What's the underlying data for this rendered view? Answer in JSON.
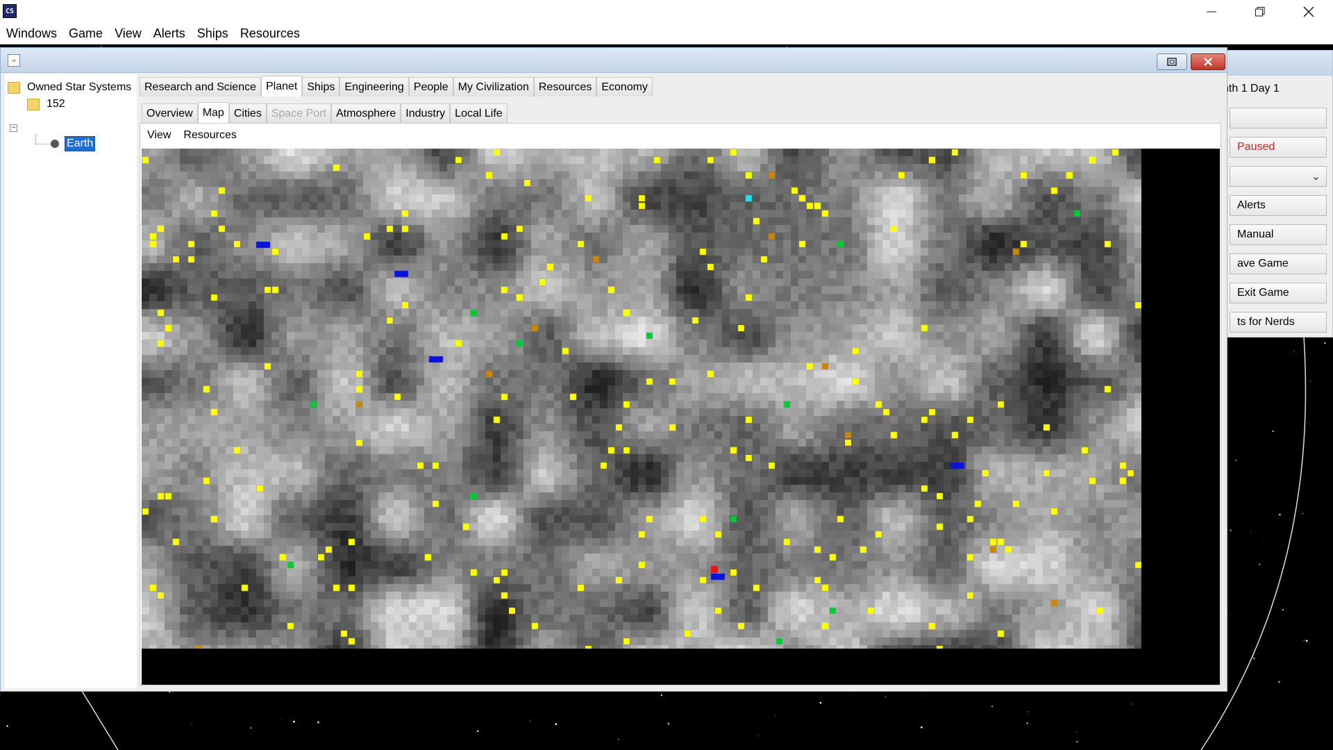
{
  "menu": [
    "Windows",
    "Game",
    "View",
    "Alerts",
    "Ships",
    "Resources"
  ],
  "tree": {
    "root": "Owned Star Systems",
    "system": "152",
    "planet": "Earth"
  },
  "tabs": {
    "outer": [
      {
        "label": "Research and Science",
        "active": false
      },
      {
        "label": "Planet",
        "active": true
      },
      {
        "label": "Ships",
        "active": false
      },
      {
        "label": "Engineering",
        "active": false
      },
      {
        "label": "People",
        "active": false
      },
      {
        "label": "My Civilization",
        "active": false
      },
      {
        "label": "Resources",
        "active": false
      },
      {
        "label": "Economy",
        "active": false
      }
    ],
    "inner": [
      {
        "label": "Overview",
        "active": false,
        "disabled": false
      },
      {
        "label": "Map",
        "active": true,
        "disabled": false
      },
      {
        "label": "Cities",
        "active": false,
        "disabled": false
      },
      {
        "label": "Space Port",
        "active": false,
        "disabled": true
      },
      {
        "label": "Atmosphere",
        "active": false,
        "disabled": false
      },
      {
        "label": "Industry",
        "active": false,
        "disabled": false
      },
      {
        "label": "Local Life",
        "active": false,
        "disabled": false
      }
    ]
  },
  "content_menu": {
    "view": "View",
    "resources": "Resources"
  },
  "right_panel": {
    "date": "nth 1 Day 1",
    "status": "Paused",
    "alerts": "Alerts",
    "manual": "Manual",
    "save": "ave Game",
    "exit": "Exit Game",
    "nerds": "ts for Nerds"
  },
  "colors": {
    "resource_yellow": "#ffff00",
    "resource_orange": "#c8860a",
    "resource_green": "#00cc33",
    "resource_blue": "#0a14d8",
    "resource_cyan": "#21e0ee",
    "resource_red": "#ee1111",
    "selection": "#1c6fd8",
    "paused": "#d62020"
  },
  "icons": [
    "app-icon",
    "window-minimize-icon",
    "window-maximize-icon",
    "window-close-icon",
    "folder-icon",
    "planet-icon",
    "frame-restore-icon",
    "frame-close-icon",
    "chevron-down-icon"
  ]
}
